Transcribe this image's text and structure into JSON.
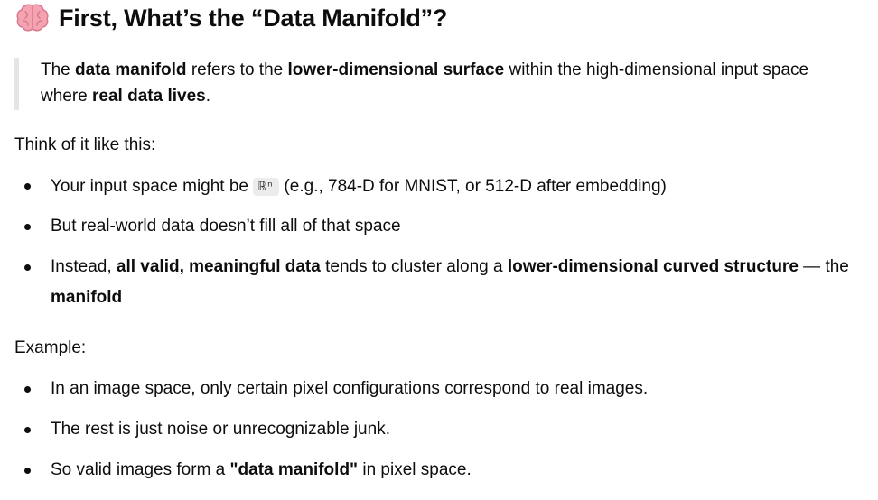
{
  "heading": {
    "icon": "brain-icon",
    "text": "First, What’s the “Data Manifold”?"
  },
  "quote": {
    "pre1": "The ",
    "b1": "data manifold",
    "mid1": " refers to the ",
    "b2": "lower-dimensional surface",
    "mid2": " within the high-dimensional input space where ",
    "b3": "real data lives",
    "end": "."
  },
  "think_intro": "Think of it like this:",
  "bullets1": {
    "b1_pre": "Your input space might be ",
    "b1_code": "ℝⁿ",
    "b1_post": " (e.g., 784-D for MNIST, or 512-D after embedding)",
    "b2": "But real-world data doesn’t fill all of that space",
    "b3_pre": "Instead, ",
    "b3_bold1": "all valid, meaningful data",
    "b3_mid": " tends to cluster along a ",
    "b3_bold2": "lower-dimensional curved structure",
    "b3_post": " — the ",
    "b3_bold3": "manifold"
  },
  "example_intro": "Example:",
  "bullets2": {
    "b1": "In an image space, only certain pixel configurations correspond to real images.",
    "b2": "The rest is just noise or unrecognizable junk.",
    "b3_pre": "So valid images form a ",
    "b3_bold": "\"data manifold\"",
    "b3_post": " in pixel space."
  }
}
